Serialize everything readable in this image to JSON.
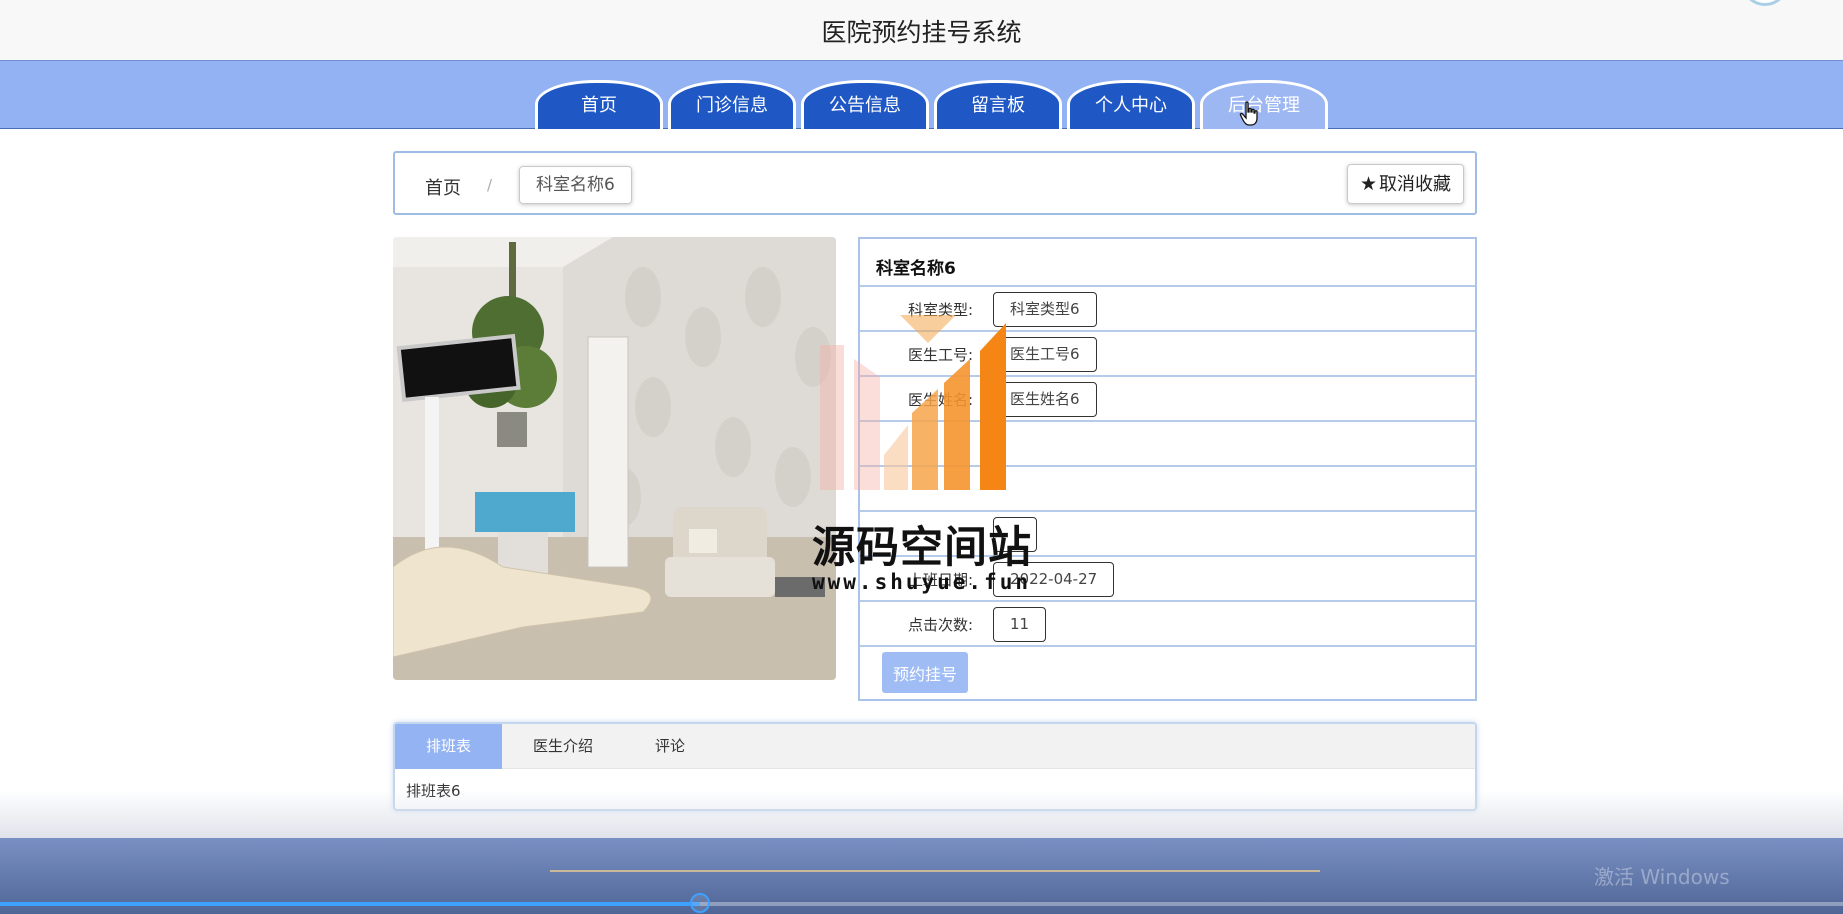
{
  "app": {
    "title": "医院预约挂号系统"
  },
  "nav": {
    "tabs": [
      {
        "label": "首页"
      },
      {
        "label": "门诊信息"
      },
      {
        "label": "公告信息"
      },
      {
        "label": "留言板"
      },
      {
        "label": "个人中心"
      },
      {
        "label": "后台管理"
      }
    ]
  },
  "breadcrumb": {
    "home": "首页",
    "separator": "/",
    "current": "科室名称6"
  },
  "favorite": {
    "icon": "star-icon",
    "label": "取消收藏"
  },
  "detail": {
    "title": "科室名称6",
    "fields": [
      {
        "label": "科室类型:",
        "value": "科室类型6"
      },
      {
        "label": "医生工号:",
        "value": "医生工号6"
      },
      {
        "label": "医生姓名:",
        "value": "医生姓名6"
      },
      {
        "label": "",
        "value": ""
      },
      {
        "label": "",
        "value": ""
      },
      {
        "label": "",
        "value": ""
      },
      {
        "label": "上班日期:",
        "value": "2022-04-27"
      },
      {
        "label": "点击次数:",
        "value": "11"
      }
    ],
    "book_label": "预约挂号"
  },
  "watermark": {
    "text": "源码空间站",
    "url": "www.shuyue.fun"
  },
  "tabs": {
    "items": [
      {
        "label": "排班表"
      },
      {
        "label": "医生介绍"
      },
      {
        "label": "评论"
      }
    ],
    "content": "排班表6"
  },
  "player": {
    "progress": 0.38,
    "accent": "#3ea0ff"
  },
  "os_overlay": {
    "text": "激活 Windows"
  },
  "colors": {
    "nav_tab": "#1f58c4",
    "nav_bar": "#92b2f3",
    "tab_active": "#93b3f3",
    "book_button": "#9fbdf4"
  }
}
